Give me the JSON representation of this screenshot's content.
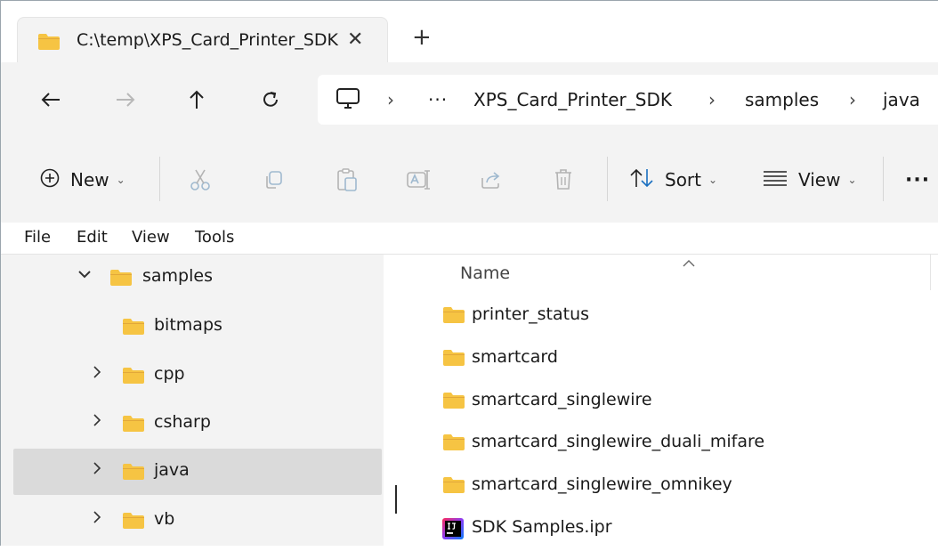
{
  "window": {
    "tab_title": "C:\\temp\\XPS_Card_Printer_SDK"
  },
  "colors": {
    "folder_yellow": "#f6c443",
    "folder_dark": "#e2a83a",
    "selected_bg": "#dadada",
    "chrome_bg": "#f3f3f3"
  },
  "navbar": {
    "breadcrumb": [
      "XPS_Card_Printer_SDK",
      "samples",
      "java"
    ],
    "overflow": "···"
  },
  "commands": {
    "new_label": "New",
    "sort_label": "Sort",
    "view_label": "View",
    "more": "···"
  },
  "menu": [
    "File",
    "Edit",
    "View",
    "Tools"
  ],
  "tree": [
    {
      "label": "samples",
      "expanded": true
    },
    {
      "label": "bitmaps"
    },
    {
      "label": "cpp"
    },
    {
      "label": "csharp"
    },
    {
      "label": "java",
      "selected": true
    },
    {
      "label": "vb"
    }
  ],
  "content": {
    "column_name": "Name",
    "files": [
      {
        "label": "printer_status",
        "icon": "folder-icon"
      },
      {
        "label": "smartcard",
        "icon": "folder-icon"
      },
      {
        "label": "smartcard_singlewire",
        "icon": "folder-icon"
      },
      {
        "label": "smartcard_singlewire_duali_mifare",
        "icon": "folder-icon"
      },
      {
        "label": "smartcard_singlewire_omnikey",
        "icon": "folder-icon"
      },
      {
        "label": "SDK Samples.ipr",
        "icon": "intellij-project-icon"
      }
    ]
  }
}
